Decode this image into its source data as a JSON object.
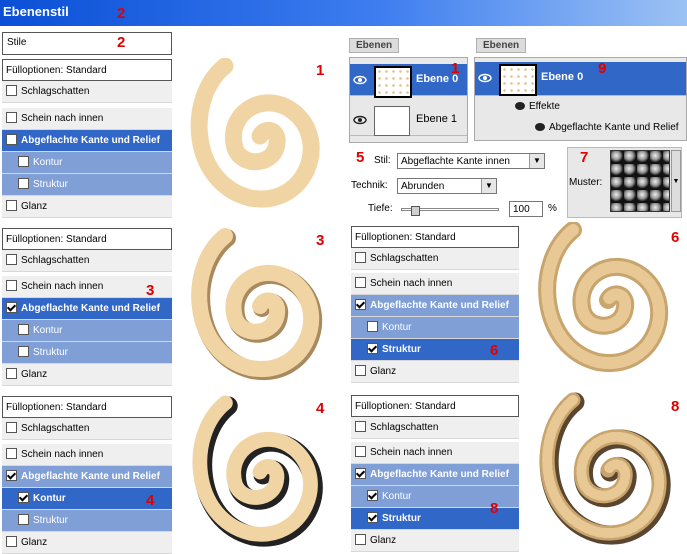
{
  "window": {
    "title": "Ebenenstil"
  },
  "markers": {
    "m1a": "1",
    "m1b": "1",
    "m2a": "2",
    "m2b": "2",
    "m3": "3",
    "m3b": "3",
    "m4": "4",
    "m4b": "4",
    "m5": "5",
    "m6a": "6",
    "m6b": "6",
    "m7": "7",
    "m8a": "8",
    "m8b": "8",
    "m9": "9"
  },
  "stile_label": "Stile",
  "panels": {
    "p1": {
      "header": "Fülloptionen: Standard",
      "items": [
        {
          "label": "Schlagschatten",
          "checked": false
        },
        {
          "label": "Schein nach innen",
          "checked": false
        },
        {
          "label": "Abgeflachte Kante und Relief",
          "checked": false
        },
        {
          "label": "Kontur",
          "checked": false
        },
        {
          "label": "Struktur",
          "checked": false
        },
        {
          "label": "Glanz",
          "checked": false
        }
      ]
    },
    "p3": {
      "header": "Fülloptionen: Standard",
      "items": [
        {
          "label": "Schlagschatten"
        },
        {
          "label": "Schein nach innen"
        },
        {
          "label": "Abgeflachte Kante und Relief"
        },
        {
          "label": "Kontur"
        },
        {
          "label": "Struktur"
        },
        {
          "label": "Glanz"
        }
      ]
    },
    "p4": {
      "header": "Fülloptionen: Standard",
      "items": [
        {
          "label": "Schlagschatten"
        },
        {
          "label": "Schein nach innen"
        },
        {
          "label": "Abgeflachte Kante und Relief"
        },
        {
          "label": "Kontur"
        },
        {
          "label": "Struktur"
        },
        {
          "label": "Glanz"
        }
      ]
    },
    "p6": {
      "header": "Fülloptionen: Standard",
      "items": [
        {
          "label": "Schlagschatten"
        },
        {
          "label": "Schein nach innen"
        },
        {
          "label": "Abgeflachte Kante und Relief"
        },
        {
          "label": "Kontur"
        },
        {
          "label": "Struktur"
        },
        {
          "label": "Glanz"
        }
      ]
    },
    "p8": {
      "header": "Fülloptionen: Standard",
      "items": [
        {
          "label": "Schlagschatten"
        },
        {
          "label": "Schein nach innen"
        },
        {
          "label": "Abgeflachte Kante und Relief"
        },
        {
          "label": "Kontur"
        },
        {
          "label": "Struktur"
        },
        {
          "label": "Glanz"
        }
      ]
    }
  },
  "layers_left": {
    "tab": "Ebenen",
    "layers": [
      {
        "name": "Ebene 0",
        "selected": true
      },
      {
        "name": "Ebene 1",
        "selected": false
      }
    ]
  },
  "layers_right": {
    "tab": "Ebenen",
    "layer": "Ebene 0",
    "effects": "Effekte",
    "effect_item": "Abgeflachte Kante und Relief"
  },
  "bevel": {
    "stil_label": "Stil:",
    "stil_value": "Abgeflachte Kante innen",
    "technik_label": "Technik:",
    "technik_value": "Abrunden",
    "tiefe_label": "Tiefe:",
    "tiefe_value": "100",
    "tiefe_unit": "%",
    "tiefe_fraction": 0.1
  },
  "pattern": {
    "label": "Muster:"
  },
  "colors": {
    "spiral": "#f1d4a4",
    "spiral_dark": "#c9a56e",
    "selection": "#3167c6",
    "sub": "#7f9fd6",
    "marker": "#e00000"
  }
}
